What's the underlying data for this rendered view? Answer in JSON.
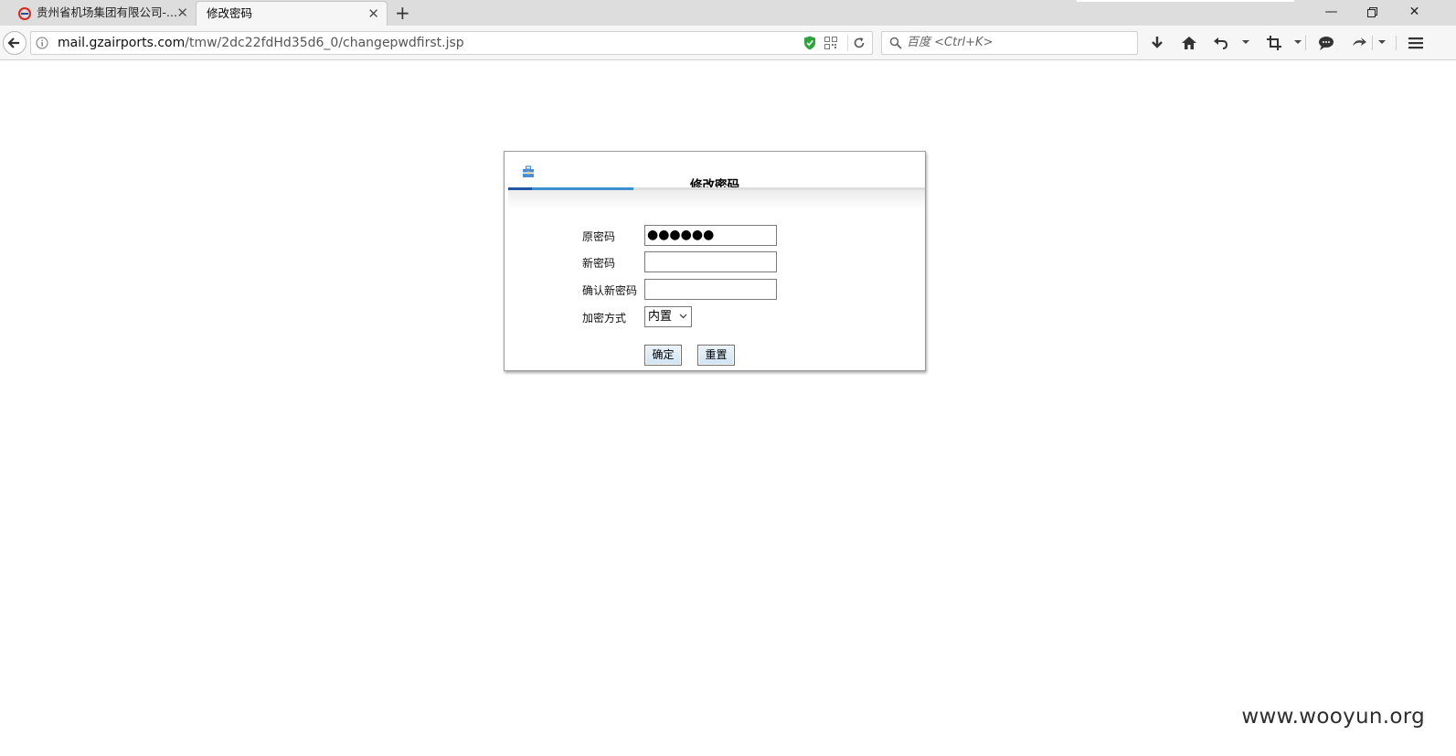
{
  "browser": {
    "tabs": [
      {
        "label": "贵州省机场集团有限公司-..."
      },
      {
        "label": "修改密码"
      }
    ],
    "url": {
      "host": "mail.gzairports.com",
      "path": "/tmw/2dc22fdHd35d6_0/changepwdfirst.jsp"
    },
    "search_placeholder": "百度 <Ctrl+K>"
  },
  "dialog": {
    "title": "修改密码",
    "fields": {
      "old_password_label": "原密码",
      "old_password_value": "●●●●●●",
      "new_password_label": "新密码",
      "confirm_password_label": "确认新密码",
      "encryption_label": "加密方式",
      "encryption_value": "内置"
    },
    "buttons": {
      "confirm": "确定",
      "reset": "重置"
    }
  },
  "watermark": "www.wooyun.org",
  "colors": {
    "accent_blue": "#3d8fd0",
    "accent_dark_blue": "#2456a6",
    "shield_green": "#2ea43c",
    "favicon_red": "#d9261c"
  }
}
